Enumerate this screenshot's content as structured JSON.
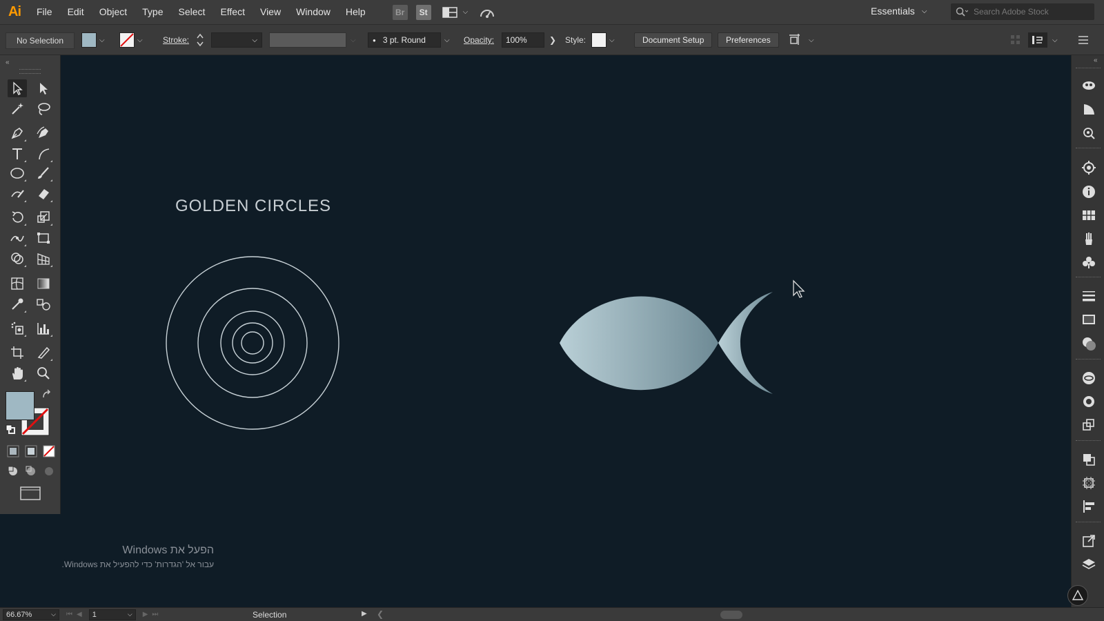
{
  "app": {
    "logo": "Ai"
  },
  "menu": [
    "File",
    "Edit",
    "Object",
    "Type",
    "Select",
    "Effect",
    "View",
    "Window",
    "Help"
  ],
  "app_chips": {
    "bridge": "Br",
    "stock": "St"
  },
  "workspace": {
    "label": "Essentials"
  },
  "stock_search": {
    "placeholder": "Search Adobe Stock"
  },
  "control_bar": {
    "selection_status": "No Selection",
    "fill_color": "#9fb8c3",
    "stroke_label": "Stroke:",
    "brush_label": "3 pt. Round",
    "opacity_label": "Opacity:",
    "opacity_value": "100%",
    "style_label": "Style:",
    "document_setup": "Document Setup",
    "preferences": "Preferences"
  },
  "canvas": {
    "title": "GOLDEN CIRCLES",
    "fish_gradient": [
      "#b9cfd6",
      "#6e8a95"
    ],
    "circle_stroke": "#c9d3d8"
  },
  "watermark": {
    "line1": "הפעל את Windows",
    "line2": "עבור אל 'הגדרות' כדי להפעיל את Windows."
  },
  "status_bar": {
    "zoom": "66.67%",
    "page": "1",
    "tool_status": "Selection"
  },
  "colors": {
    "canvas_bg": "#0f1c26",
    "ui_panel": "#3c3c3c",
    "ai_brand": "#ff9a00"
  }
}
